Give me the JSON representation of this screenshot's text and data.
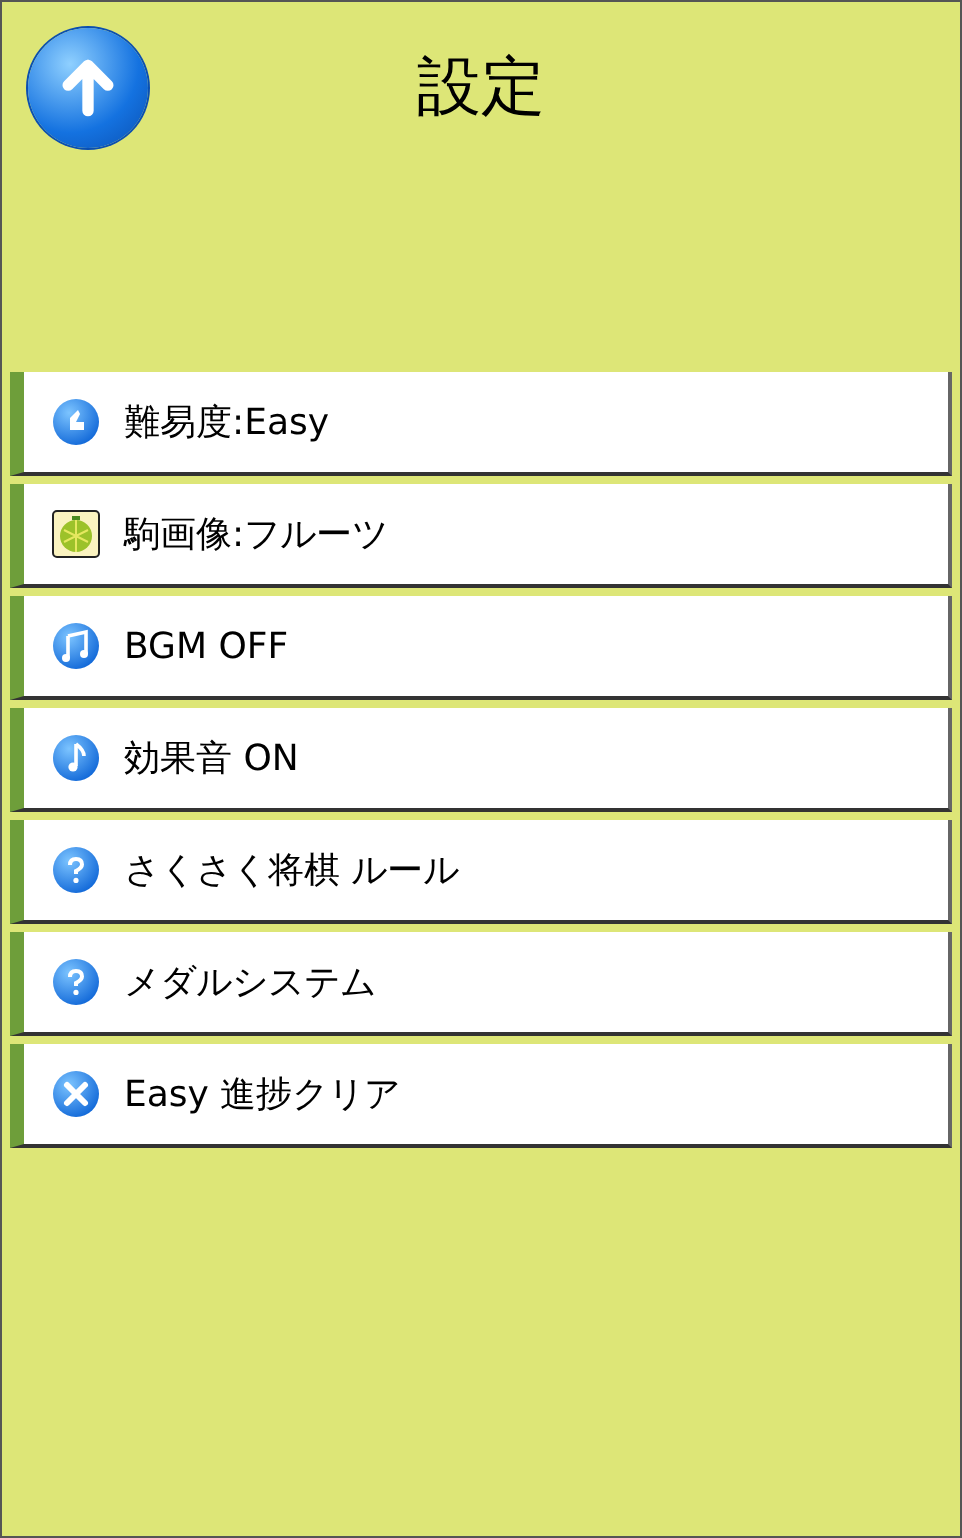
{
  "header": {
    "title": "設定"
  },
  "menu": [
    {
      "kind": "difficulty",
      "label": "難易度:Easy"
    },
    {
      "kind": "fruit",
      "label": "駒画像:フルーツ"
    },
    {
      "kind": "notes",
      "label": "BGM OFF"
    },
    {
      "kind": "note",
      "label": "効果音 ON"
    },
    {
      "kind": "help",
      "label": "さくさく将棋 ルール"
    },
    {
      "kind": "help",
      "label": "メダルシステム"
    },
    {
      "kind": "clear",
      "label": "Easy 進捗クリア"
    }
  ]
}
